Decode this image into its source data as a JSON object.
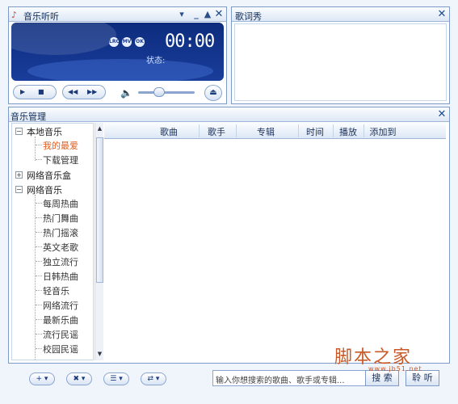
{
  "player": {
    "title": "音乐听听",
    "time": "00:00",
    "status_label": "状态:",
    "mode_buttons": [
      "LRC",
      "MV",
      "OK"
    ]
  },
  "lyrics": {
    "title": "歌词秀"
  },
  "manager": {
    "title": "音乐管理",
    "columns": [
      "歌曲",
      "歌手",
      "专辑",
      "时间",
      "播放",
      "添加到"
    ],
    "tree": {
      "local": "本地音乐",
      "local_children": [
        "我的最爱",
        "下载管理"
      ],
      "netbox": "网络音乐盒",
      "net": "网络音乐",
      "net_children": [
        "每周热曲",
        "热门舞曲",
        "热门摇滚",
        "英文老歌",
        "独立流行",
        "日韩热曲",
        "轻音乐",
        "网络流行",
        "最新乐曲",
        "流行民谣",
        "校园民谣"
      ]
    }
  },
  "toolbar": {
    "search_placeholder": "输入你想搜索的歌曲、歌手或专辑...",
    "search_button": "搜 索",
    "listen_button": "聆 听"
  },
  "watermark": {
    "text": "脚本之家",
    "url": "www.jb51.net"
  },
  "colors": {
    "accent": "#1a3d9b",
    "selected": "#e35b1a",
    "border": "#7d9bc6"
  }
}
